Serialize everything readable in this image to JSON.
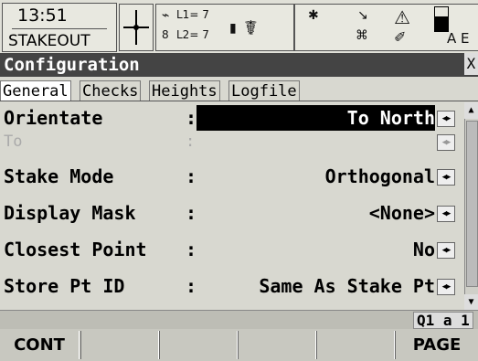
{
  "status": {
    "time": "13:51",
    "program": "STAKEOUT",
    "gps": {
      "l1": "L1= 7",
      "l2": "L2= 7",
      "sats": "8"
    },
    "icons": [
      "crosshair-icon",
      "satellite-icon",
      "battery-icon",
      "person-icon",
      "bluetooth-icon",
      "radio-icon",
      "memory-icon",
      "alert-icon",
      "battery-level-icon"
    ],
    "trailing": "A E"
  },
  "title": "Configuration",
  "close_label": "X",
  "tabs": [
    {
      "label": "General",
      "active": true
    },
    {
      "label": "Checks",
      "active": false
    },
    {
      "label": "Heights",
      "active": false
    },
    {
      "label": "Logfile",
      "active": false
    }
  ],
  "rows": [
    {
      "label": "Orientate",
      "value": "To North",
      "selected": true,
      "enabled": true
    },
    {
      "label": "To",
      "value": "",
      "selected": false,
      "enabled": false
    },
    {
      "label": "Stake Mode",
      "value": "Orthogonal",
      "selected": false,
      "enabled": true
    },
    {
      "label": "Display Mask",
      "value": "<None>",
      "selected": false,
      "enabled": true
    },
    {
      "label": "Closest Point",
      "value": "No",
      "selected": false,
      "enabled": true
    },
    {
      "label": "Store Pt ID",
      "value": "Same As Stake Pt",
      "selected": false,
      "enabled": true
    }
  ],
  "colon": ":",
  "spinner_glyph": "◀▶",
  "info": "Q1 a 1",
  "softkeys": [
    "CONT",
    "",
    "",
    "",
    "",
    "PAGE"
  ]
}
